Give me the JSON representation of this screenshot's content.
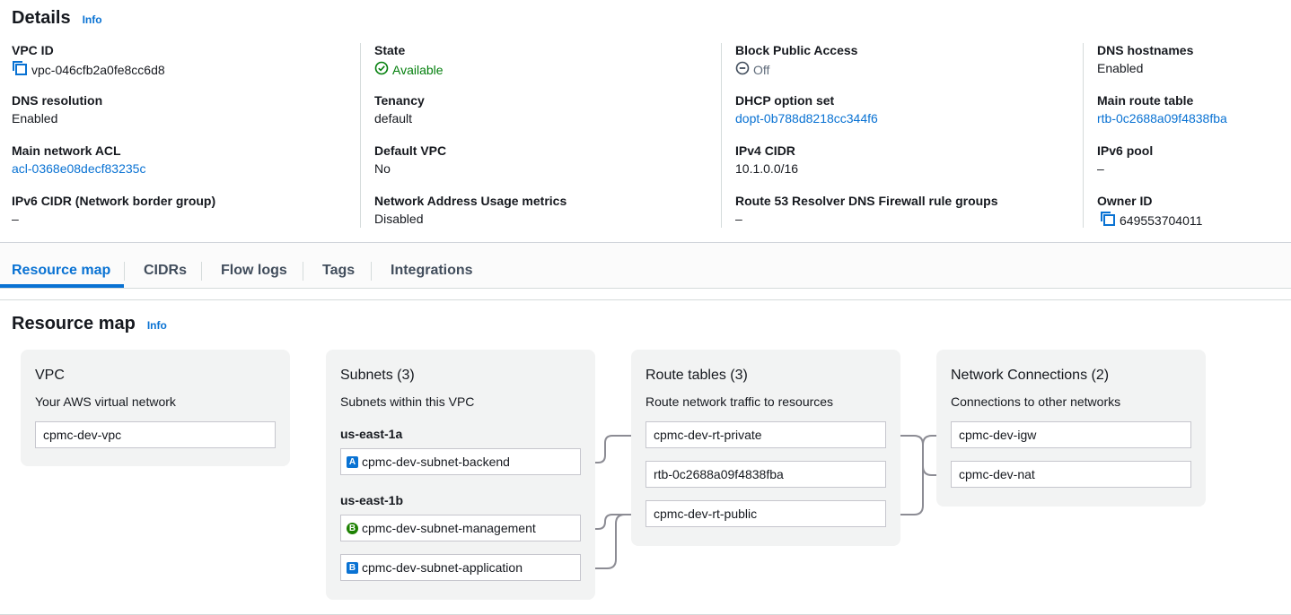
{
  "details": {
    "title": "Details",
    "info": "Info",
    "col1": [
      {
        "label": "VPC ID",
        "value": "vpc-046cfb2a0fe8cc6d8"
      },
      {
        "label": "DNS resolution",
        "value": "Enabled"
      },
      {
        "label": "Main network ACL",
        "value": "acl-0368e08decf83235c"
      },
      {
        "label": "IPv6 CIDR (Network border group)",
        "value": "–"
      }
    ],
    "col2": [
      {
        "label": "State",
        "value": "Available"
      },
      {
        "label": "Tenancy",
        "value": "default"
      },
      {
        "label": "Default VPC",
        "value": "No"
      },
      {
        "label": "Network Address Usage metrics",
        "value": "Disabled"
      }
    ],
    "col3": [
      {
        "label": "Block Public Access",
        "value": "Off"
      },
      {
        "label": "DHCP option set",
        "value": "dopt-0b788d8218cc344f6"
      },
      {
        "label": "IPv4 CIDR",
        "value": "10.1.0.0/16"
      },
      {
        "label": "Route 53 Resolver DNS Firewall rule groups",
        "value": "–"
      }
    ],
    "col4": [
      {
        "label": "DNS hostnames",
        "value": "Enabled"
      },
      {
        "label": "Main route table",
        "value": "rtb-0c2688a09f4838fba"
      },
      {
        "label": "IPv6 pool",
        "value": "–"
      },
      {
        "label": "Owner ID",
        "value": "649553704011"
      }
    ]
  },
  "tabs": [
    "Resource map",
    "CIDRs",
    "Flow logs",
    "Tags",
    "Integrations"
  ],
  "resource_map": {
    "title": "Resource map",
    "info": "Info",
    "vpc": {
      "title": "VPC",
      "subtitle": "Your AWS virtual network",
      "items": [
        "cpmc-dev-vpc"
      ]
    },
    "subnets": {
      "title": "Subnets (3)",
      "subtitle": "Subnets within this VPC",
      "zones": [
        {
          "name": "us-east-1a",
          "items": [
            {
              "badge": "A",
              "name": "cpmc-dev-subnet-backend"
            }
          ]
        },
        {
          "name": "us-east-1b",
          "items": [
            {
              "badge": "B",
              "name": "cpmc-dev-subnet-management"
            },
            {
              "badge": "B",
              "name": "cpmc-dev-subnet-application"
            }
          ]
        }
      ]
    },
    "route_tables": {
      "title": "Route tables (3)",
      "subtitle": "Route network traffic to resources",
      "items": [
        "cpmc-dev-rt-private",
        "rtb-0c2688a09f4838fba",
        "cpmc-dev-rt-public"
      ]
    },
    "network_connections": {
      "title": "Network Connections (2)",
      "subtitle": "Connections to other networks",
      "items": [
        "cpmc-dev-igw",
        "cpmc-dev-nat"
      ]
    }
  },
  "colors": {
    "link": "#0972d3",
    "success": "#037f0c",
    "card": "#f2f3f3"
  }
}
